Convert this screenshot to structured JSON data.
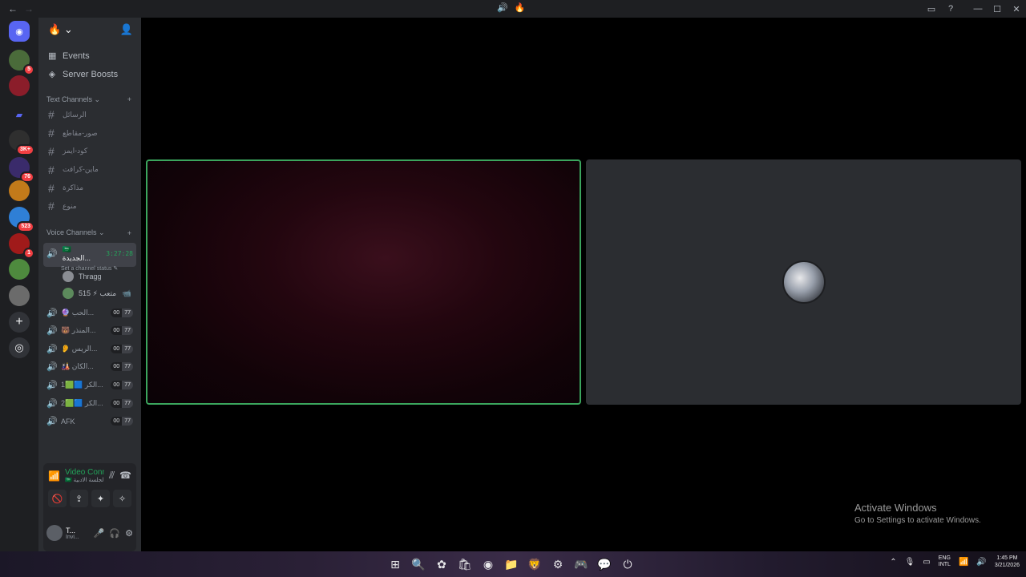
{
  "titlebar": {
    "back_icon": "←",
    "forward_icon": "→",
    "center_icons": [
      "🔊",
      "🔥"
    ],
    "right_icons": [
      "inbox-icon",
      "help-icon"
    ],
    "minimize": "—",
    "maximize": "☐",
    "close": "✕"
  },
  "servers": [
    {
      "name": "server-1",
      "badge": "5",
      "color": "#4a6b3a"
    },
    {
      "name": "server-2",
      "badge": "",
      "color": "#8b1d2a"
    },
    {
      "name": "folder",
      "badge": "",
      "color": "#5865f2"
    },
    {
      "name": "server-3",
      "badge": "3K+",
      "color": "#2f2f2f"
    },
    {
      "name": "server-4",
      "badge": "76",
      "color": "#3a2b6b"
    },
    {
      "name": "server-5",
      "badge": "",
      "color": "#c27a1a"
    },
    {
      "name": "server-6",
      "badge": "523",
      "color": "#2f7fd6"
    },
    {
      "name": "server-7",
      "badge": "1",
      "color": "#a01a1a"
    },
    {
      "name": "server-8",
      "badge": "",
      "color": "#4e8a3e"
    },
    {
      "name": "server-9",
      "badge": "",
      "color": "#6b6b6b"
    }
  ],
  "sidebar": {
    "server_name": "🔥",
    "events_label": "Events",
    "boosts_label": "Server Boosts",
    "text_category": "Text Channels",
    "text_channels": [
      "الرسائل",
      "صور-مقاطع",
      "كود-ايمز",
      "ماين-كرافت",
      "مذاكرة",
      "منوع"
    ],
    "voice_category": "Voice Channels",
    "active_voice": {
      "name": "🇸🇦 الجديدة...",
      "timer": "3:27:28",
      "status": "Set a channel status ✎",
      "members": [
        {
          "name": "Thragg",
          "color": "#8a8d93",
          "cam": ""
        },
        {
          "name": "515 ⚡ متعب",
          "color": "#5c8a5c",
          "cam": "📹"
        }
      ]
    },
    "voice_channels": [
      {
        "name": "🔮 الحب...",
        "left": "00",
        "right": "77"
      },
      {
        "name": "🐻 المنذر...",
        "left": "00",
        "right": "77"
      },
      {
        "name": "👂 الريس...",
        "left": "00",
        "right": "77"
      },
      {
        "name": "🎎 الكان...",
        "left": "00",
        "right": "77"
      },
      {
        "name": "1🟩🟦 الكر...",
        "left": "00",
        "right": "77"
      },
      {
        "name": "2🟩🟦 الكر...",
        "left": "00",
        "right": "77"
      },
      {
        "name": "AFK",
        "left": "00",
        "right": "77"
      }
    ]
  },
  "voice_panel": {
    "status": "Video Connected",
    "channel": "🇸🇦 الجلسة الادبية / 🇸🇦 ...",
    "buttons": [
      "🚫",
      "⇪",
      "✦",
      "✧"
    ],
    "user_name": "T...",
    "user_status": "Invi..."
  },
  "activate": {
    "line1": "Activate Windows",
    "line2": "Go to Settings to activate Windows."
  },
  "taskbar": {
    "apps": [
      "⊞",
      "🔍",
      "✿",
      "🛍",
      "◉",
      "📁",
      "🦁",
      "⚙",
      "🎮",
      "💬",
      "⏻"
    ],
    "lang_1": "ENG",
    "lang_2": "INTL",
    "time": "1:45 PM",
    "date": "3/21/2026"
  }
}
